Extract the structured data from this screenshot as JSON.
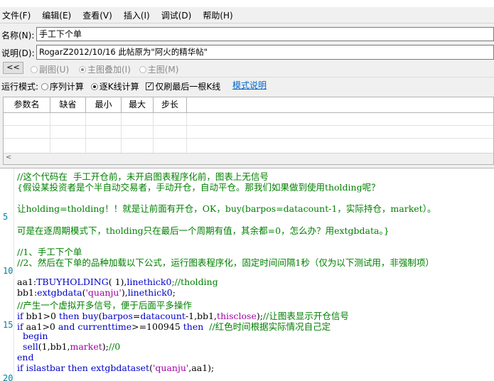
{
  "menu": [
    "文件(F)",
    "编辑(E)",
    "查看(V)",
    "插入(I)",
    "调试(D)",
    "帮助(H)"
  ],
  "name": {
    "label": "名称(N):",
    "value": "手工下个单"
  },
  "desc": {
    "label": "说明(D):",
    "value": "RogarZ2012/10/16 此帖原为\"阿火的精华帖\""
  },
  "chart_mode": {
    "back_label": "<<",
    "options": [
      {
        "label": "副图(U)",
        "selected": false
      },
      {
        "label": "主图叠加(I)",
        "selected": true
      },
      {
        "label": "主图(M)",
        "selected": false
      }
    ]
  },
  "run_mode": {
    "label": "运行模式:",
    "options": [
      {
        "label": "序列计算",
        "selected": false
      },
      {
        "label": "逐K线计算",
        "selected": true
      }
    ],
    "checkbox_label": "仅刷最后一根K线",
    "checkbox_checked": true,
    "link_label": "模式说明"
  },
  "params": {
    "columns": [
      "参数名",
      "缺省",
      "最小",
      "最大",
      "步长"
    ]
  },
  "editor": {
    "line_numbers": [
      "5",
      "10",
      "15",
      "20"
    ],
    "lines": [
      [
        [
          "c",
          "//这个代码在  手工开仓前，未开启图表程序化前，图表上无信号"
        ]
      ],
      [
        [
          "c",
          "{假设某投资者是个半自动交易者，手动开仓，自动平仓。那我们如果做到使用tholding呢？"
        ]
      ],
      [],
      [
        [
          "c",
          "让holding=tholding！！就是让前面有开仓，OK，buy(barpos=datacount-1，实际持仓，market）。"
        ]
      ],
      [],
      [
        [
          "c",
          "可是在逐周期模式下，tholding只在最后一个周期有值，其余都=0，怎么办？用extgbdata。}"
        ]
      ],
      [],
      [
        [
          "c",
          "//1、手工下个单"
        ]
      ],
      [
        [
          "c",
          "//2、然后在下单的品种加载以下公式，运行图表程序化，固定时间间隔1秒（仅为以下测试用，非强制项）"
        ]
      ],
      [],
      [
        [
          "p",
          "aa1:"
        ],
        [
          "k",
          "TBUYHOLDING"
        ],
        [
          "p",
          "( 1),"
        ],
        [
          "k",
          "linethick0"
        ],
        [
          "c",
          ";//tholding"
        ]
      ],
      [
        [
          "p",
          "bb1:"
        ],
        [
          "k",
          "extgbdata"
        ],
        [
          "p",
          "("
        ],
        [
          "s",
          "'quanju'"
        ],
        [
          "p",
          "),"
        ],
        [
          "k",
          "linethick0"
        ],
        [
          "p",
          ";"
        ]
      ],
      [
        [
          "c",
          "//产生一个虚拟开多信号，便于后面平多操作"
        ]
      ],
      [
        [
          "k",
          "if"
        ],
        [
          "p",
          " bb1>0 "
        ],
        [
          "k",
          "then"
        ],
        [
          "p",
          " "
        ],
        [
          "k",
          "buy"
        ],
        [
          "p",
          "("
        ],
        [
          "k",
          "barpos"
        ],
        [
          "p",
          "="
        ],
        [
          "k",
          "datacount"
        ],
        [
          "p",
          "-1,bb1,"
        ],
        [
          "s",
          "thisclose"
        ],
        [
          "p",
          ");"
        ],
        [
          "c",
          "//让图表显示开仓信号"
        ]
      ],
      [
        [
          "k",
          "if"
        ],
        [
          "p",
          " aa1>0 "
        ],
        [
          "k",
          "and"
        ],
        [
          "p",
          " "
        ],
        [
          "k",
          "currenttime"
        ],
        [
          "p",
          ">=100945 "
        ],
        [
          "k",
          "then"
        ],
        [
          "p",
          "  "
        ],
        [
          "c",
          "//红色时间根据实际情况自己定"
        ]
      ],
      [
        [
          "p",
          "  "
        ],
        [
          "k",
          "begin"
        ]
      ],
      [
        [
          "p",
          "  "
        ],
        [
          "k",
          "sell"
        ],
        [
          "p",
          "(1,bb1,"
        ],
        [
          "s",
          "market"
        ],
        [
          "p",
          ");"
        ],
        [
          "c",
          "//0"
        ]
      ],
      [
        [
          "k",
          "end"
        ]
      ],
      [
        [
          "k",
          "if"
        ],
        [
          "p",
          " "
        ],
        [
          "k",
          "islastbar"
        ],
        [
          "p",
          " "
        ],
        [
          "k",
          "then"
        ],
        [
          "p",
          " "
        ],
        [
          "k",
          "extgbdataset"
        ],
        [
          "p",
          "("
        ],
        [
          "s",
          "'quanju'"
        ],
        [
          "p",
          ",aa1);"
        ]
      ]
    ]
  }
}
